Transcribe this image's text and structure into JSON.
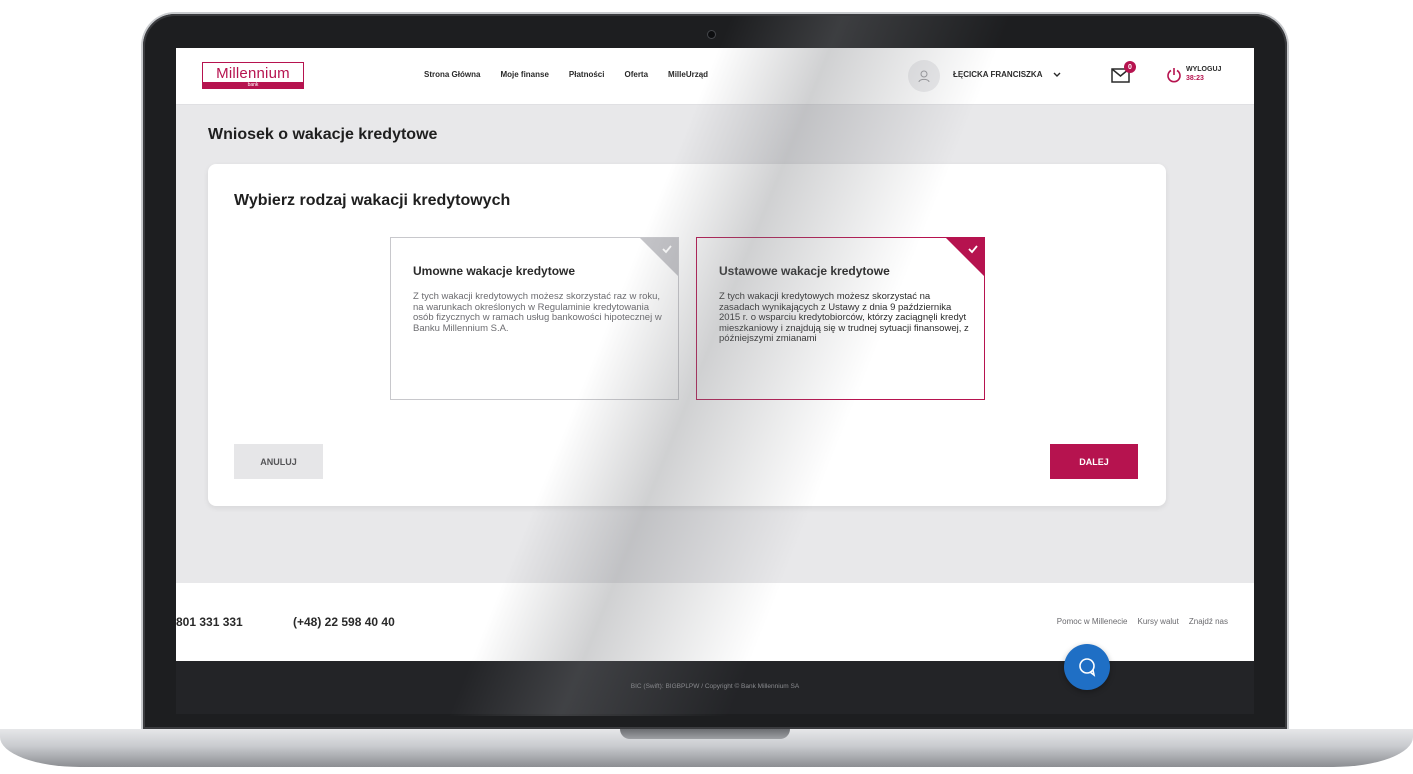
{
  "header": {
    "logo_text": "Millennium",
    "logo_sub": "bank",
    "nav": [
      "Strona Główna",
      "Moje finanse",
      "Płatności",
      "Oferta",
      "MilleUrząd"
    ],
    "user_name": "ŁĘCICKA FRANCISZKA",
    "mail_badge": "0",
    "logout_label": "WYLOGUJ",
    "session_time": "38:23"
  },
  "page": {
    "title": "Wniosek o wakacje kredytowe"
  },
  "card": {
    "title": "Wybierz rodzaj wakacji kredytowych",
    "options": [
      {
        "title": "Umowne wakacje kredytowe",
        "description": "Z tych wakacji kredytowych możesz skorzystać raz w roku, na warunkach określonych w Regulaminie kredytowania osób fizycznych w ramach usług bankowości hipotecznej w Banku Millennium S.A.",
        "selected": false
      },
      {
        "title": "Ustawowe wakacje kredytowe",
        "description": "Z tych wakacji kredytowych możesz skorzystać na zasadach wynikających z Ustawy z dnia 9 października 2015 r. o wsparciu kredytobiorców, którzy zaciągnęli kredyt mieszkaniowy i znajdują się w trudnej sytuacji finansowej, z późniejszymi zmianami",
        "selected": true
      }
    ],
    "cancel_label": "ANULUJ",
    "next_label": "DALEJ"
  },
  "footer": {
    "phone_1": "801 331 331",
    "phone_2": "(+48) 22 598 40 40",
    "links": [
      "Pomoc w Millenecie",
      "Kursy walut",
      "Znajdź nas"
    ],
    "bottom_text": "BIC (Swift): BIGBPLPW   /   Copyright © Bank Millennium SA"
  },
  "colors": {
    "brand": "#b6134f",
    "chat": "#1f6fc5"
  },
  "icons": [
    "user-icon",
    "chevron-down-icon",
    "mail-icon",
    "power-icon",
    "check-icon",
    "chat-icon"
  ]
}
